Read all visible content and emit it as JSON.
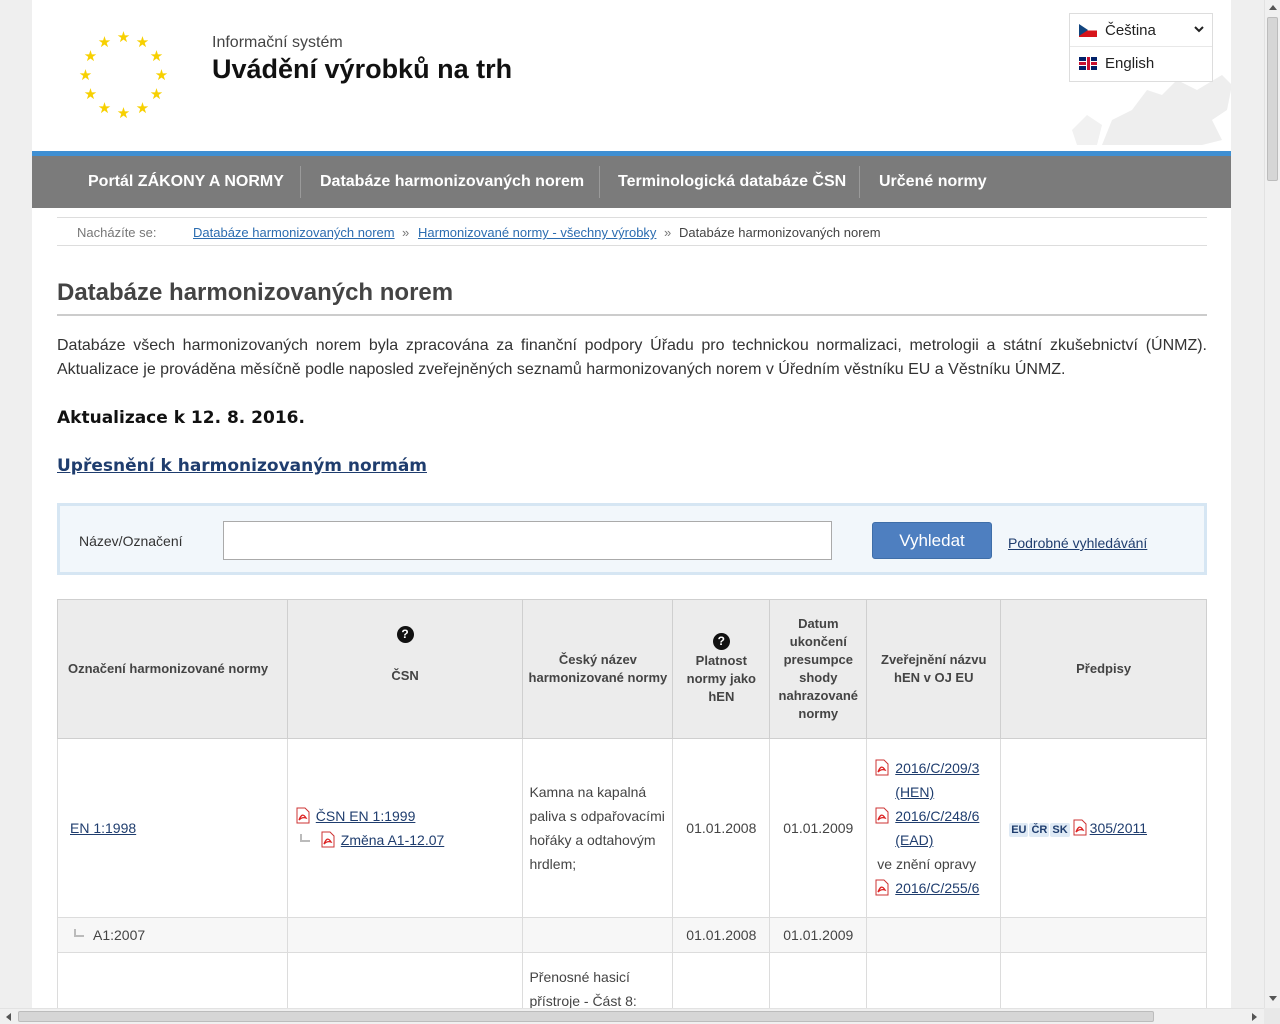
{
  "header": {
    "subtitle": "Informační systém",
    "title": "Uvádění výrobků na trh"
  },
  "languages": [
    {
      "label": "Čeština",
      "flag": "cz-flag-icon",
      "selected": true
    },
    {
      "label": "English",
      "flag": "gb-flag-icon",
      "selected": false
    }
  ],
  "nav": [
    "Portál ZÁKONY A NORMY",
    "Databáze harmonizovaných norem",
    "Terminologická databáze ČSN",
    "Určené normy"
  ],
  "breadcrumb": {
    "label": "Nacházíte se:",
    "items": [
      "Databáze harmonizovaných norem",
      "Harmonizované normy - všechny výrobky"
    ],
    "current": "Databáze harmonizovaných norem",
    "separator": "»"
  },
  "main": {
    "heading": "Databáze harmonizovaných norem",
    "intro": "Databáze všech harmonizovaných norem byla zpracována za finanční podpory Úřadu pro technickou normalizaci, metrologii a státní zkušebnictví (ÚNMZ).  Aktualizace je prováděna měsíčně podle naposled zveřejněných seznamů harmonizovaných norem v Úředním věstníku EU a Věstníku ÚNMZ.",
    "update": "Aktualizace k 12. 8. 2016.",
    "spec_link": "Upřesnění k harmonizovaným normám"
  },
  "search": {
    "label": "Název/Označení",
    "value": "",
    "placeholder": "",
    "button": "Vyhledat",
    "advanced": "Podrobné vyhledávání"
  },
  "table": {
    "headers": {
      "designation": "Označení harmonizované normy",
      "csn": "ČSN",
      "czech_name": "Český název harmonizované normy",
      "validity": "Platnost normy jako hEN",
      "end_date": "Datum ukončení presumpce shody nahrazované normy",
      "publication": "Zveřejnění názvu hEN v OJ EU",
      "regulations": "Předpisy",
      "help": "?"
    },
    "rows": [
      {
        "designation": "EN 1:1998",
        "csn_main": "ČSN EN 1:1999",
        "csn_change": "Změna A1-12.07",
        "czech_name": "Kamna na kapalná paliva s odpařovacími hořáky a odtahovým hrdlem;",
        "validity": "01.01.2008",
        "end_date": "01.01.2009",
        "pub1": "2016/C/209/3",
        "pub1_tag": "(HEN)",
        "pub2": "2016/C/248/6",
        "pub2_tag": "(EAD)",
        "pub_note": "ve znění opravy",
        "pub3": "2016/C/255/6",
        "badges": [
          "EU",
          "ČR",
          "SK"
        ],
        "regulation": "305/2011"
      },
      {
        "designation": "A1:2007",
        "validity": "01.01.2008",
        "end_date": "01.01.2009"
      },
      {
        "czech_name": "Přenosné hasicí přístroje - Část 8:"
      }
    ]
  },
  "colors": {
    "nav_bg": "#7b7b7b",
    "nav_accent": "#3f8fd2",
    "button": "#4e7fc0",
    "link": "#1f3d6e",
    "eu_star": "#f7d000"
  }
}
